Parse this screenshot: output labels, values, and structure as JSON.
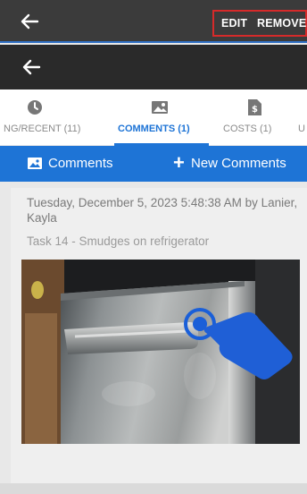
{
  "header": {
    "edit_label": "EDIT",
    "remove_label": "REMOVE"
  },
  "tabs": [
    {
      "label": "NG/RECENT (11)",
      "icon": "clock-icon",
      "active": false
    },
    {
      "label": "COMMENTS (1)",
      "icon": "image-icon",
      "active": true
    },
    {
      "label": "COSTS (1)",
      "icon": "document-dollar-icon",
      "active": false
    },
    {
      "label": "U",
      "icon": "",
      "active": false
    }
  ],
  "comments_bar": {
    "title": "Comments",
    "new_label": "New Comments"
  },
  "comment": {
    "meta": "Tuesday, December 5, 2023 5:48:38 AM by Lanier, Kayla",
    "task": "Task 14 - Smudges on refrigerator",
    "photo": "refrigerator-photo"
  },
  "colors": {
    "accent": "#1e74d6",
    "topbar": "#3b3b3b",
    "highlight": "#d62a2a"
  }
}
